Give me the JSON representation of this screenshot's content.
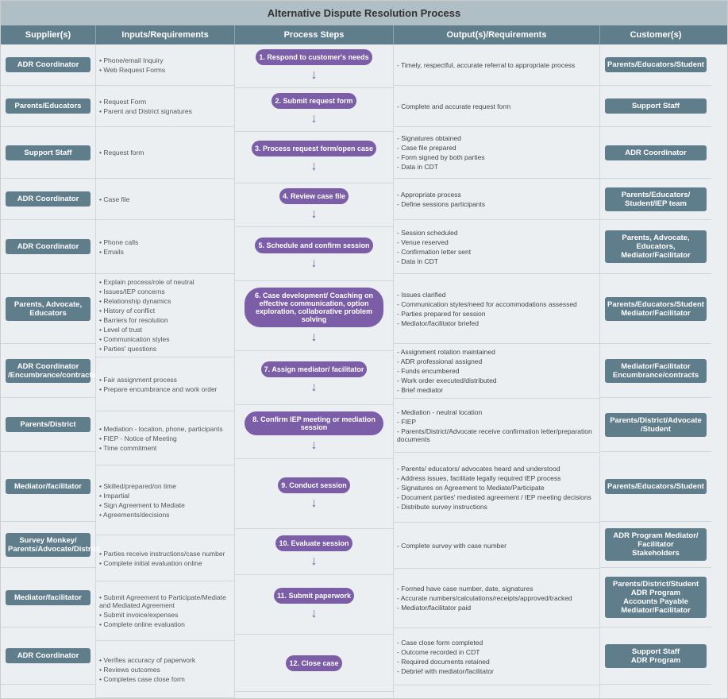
{
  "title": "Alternative Dispute Resolution Process",
  "headers": {
    "col1": "Supplier(s)",
    "col2": "Inputs/Requirements",
    "col3": "Process Steps",
    "col4": "Output(s)/Requirements",
    "col5": "Customer(s)"
  },
  "rows": [
    {
      "id": 1,
      "supplier": "ADR Coordinator",
      "inputs": [
        "Phone/email Inquiry",
        "Web Request Forms"
      ],
      "process": "1. Respond to customer's needs",
      "outputs": [
        "Timely, respectful, accurate referral to appropriate process"
      ],
      "customer": "Parents/Educators/Student"
    },
    {
      "id": 2,
      "supplier": "Parents/Educators",
      "inputs": [
        "Request Form",
        "Parent and District signatures"
      ],
      "process": "2. Submit request form",
      "outputs": [
        "Complete and accurate request form"
      ],
      "customer": "Support Staff"
    },
    {
      "id": 3,
      "supplier": "Support Staff",
      "inputs": [
        "Request form"
      ],
      "process": "3. Process request form/open case",
      "outputs": [
        "Signatures obtained",
        "Case file prepared",
        "Form signed by both parties",
        "Data in CDT"
      ],
      "customer": "ADR Coordinator"
    },
    {
      "id": 4,
      "supplier": "ADR Coordinator",
      "inputs": [
        "Case file"
      ],
      "process": "4. Review case file",
      "outputs": [
        "Appropriate process",
        "Define sessions participants"
      ],
      "customer": "Parents/Educators/\nStudent/IEP team"
    },
    {
      "id": 5,
      "supplier": "ADR Coordinator",
      "inputs": [
        "Phone calls",
        "Emails"
      ],
      "process": "5. Schedule and confirm session",
      "outputs": [
        "Session scheduled",
        "Venue reserved",
        "Confirmation letter sent",
        "Data in CDT"
      ],
      "customer": "Parents, Advocate, Educators, Mediator/Facilitator"
    },
    {
      "id": 6,
      "supplier": "Parents, Advocate, Educators",
      "inputs": [
        "Explain process/role of neutral",
        "Issues/IEP concerns",
        "Relationship dynamics",
        "History of conflict",
        "Barriers for resolution",
        "Level of trust",
        "Communication styles",
        "Parties' questions"
      ],
      "process": "6. Case development/ Coaching on effective communication, option exploration, collaborative problem solving",
      "outputs": [
        "Issues clarified",
        "Communication styles/need for accommodations assessed",
        "Parties prepared for session",
        "Mediator/facilitator briefed"
      ],
      "customer": "Parents/Educators/Student\nMediator/Facilitator"
    },
    {
      "id": 7,
      "supplier": "ADR Coordinator /Encumbrance/contracts",
      "inputs": [
        "Fair assignment process",
        "Prepare encumbrance and work order"
      ],
      "process": "7. Assign mediator/ facilitator",
      "outputs": [
        "Assignment rotation maintained",
        "ADR professional assigned",
        "Funds encumbered",
        "Work order executed/distributed",
        "Brief mediator"
      ],
      "customer": "Mediator/Facilitator\nEncumbrance/contracts"
    },
    {
      "id": 8,
      "supplier": "Parents/District",
      "inputs": [
        "Mediation - location, phone, participants",
        "FIEP - Notice of Meeting",
        "Time commitment"
      ],
      "process": "8. Confirm IEP meeting or mediation session",
      "outputs": [
        "Mediation - neutral location",
        "FIEP",
        "Parents/District/Advocate receive confirmation letter/preparation documents"
      ],
      "customer": "Parents/District/Advocate\n/Student"
    },
    {
      "id": 9,
      "supplier": "Mediator/facilitator",
      "inputs": [
        "Skilled/prepared/on time",
        "Impartial",
        "Sign Agreement to Mediate",
        "Agreements/decisions"
      ],
      "process": "9. Conduct session",
      "outputs": [
        "Parents/ educators/ advocates heard and understood",
        "Address issues, facilitate legally required IEP process",
        "Signatures on Agreement to Mediate/Participate",
        "Document parties' mediated agreement / IEP meeting decisions",
        "Distribute survey instructions"
      ],
      "customer": "Parents/Educators/Student"
    },
    {
      "id": 10,
      "supplier": "Survey Monkey/\nParents/Advocate/District",
      "inputs": [
        "Parties receive instructions/case number",
        "Complete initial evaluation online"
      ],
      "process": "10. Evaluate session",
      "outputs": [
        "Complete survey with case number"
      ],
      "customer": "ADR Program Mediator/\nFacilitator\nStakeholders"
    },
    {
      "id": 11,
      "supplier": "Mediator/facilitator",
      "inputs": [
        "Submit Agreement to Participate/Mediate and Mediated Agreement",
        "Submit invoice/expenses",
        "Complete online evaluation"
      ],
      "process": "11. Submit paperwork",
      "outputs": [
        "Formed have case number, date, signatures",
        "Accurate numbers/calculations/receipts/approved/tracked",
        "Mediator/facilitator paid"
      ],
      "customer": "Parents/District/Student\nADR Program\nAccounts Payable\nMediator/Facilitator"
    },
    {
      "id": 12,
      "supplier": "ADR Coordinator",
      "inputs": [
        "Verifies accuracy of paperwork",
        "Reviews outcomes",
        "Completes case close form"
      ],
      "process": "12. Close case",
      "outputs": [
        "Case close form completed",
        "Outcome recorded in CDT",
        "Required documents retained",
        "Debrief with mediator/facilitator"
      ],
      "customer": "Support Staff\nADR Program"
    }
  ]
}
